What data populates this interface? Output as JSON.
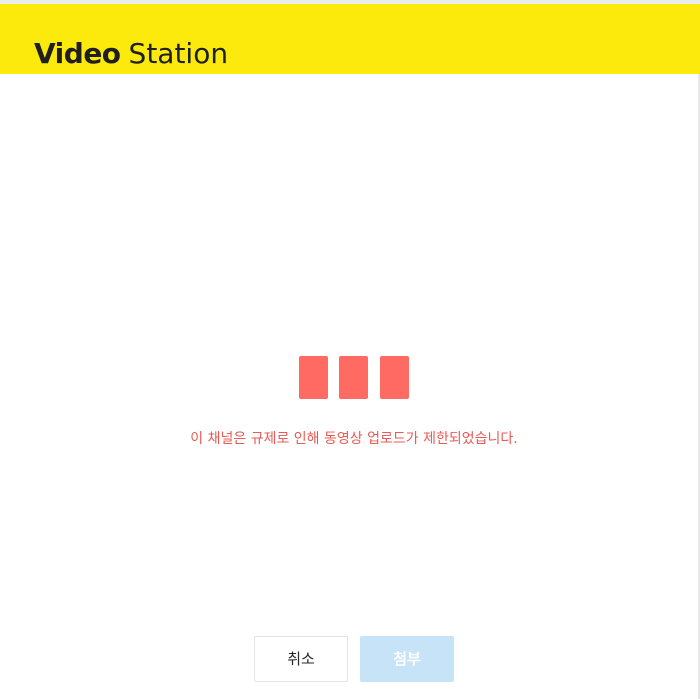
{
  "header": {
    "title_bold": "Video",
    "title_light": "Station",
    "background_color": "#fbea0c"
  },
  "notice": {
    "icon": "three-red-blocks-icon",
    "icon_color": "#ff6a63",
    "message": "이 채널은 규제로 인해 동영상 업로드가 제한되었습니다.",
    "message_color": "#e85b55"
  },
  "footer": {
    "cancel_label": "취소",
    "attach_label": "첨부",
    "attach_state": "disabled",
    "attach_color": "#c7e3f8"
  }
}
